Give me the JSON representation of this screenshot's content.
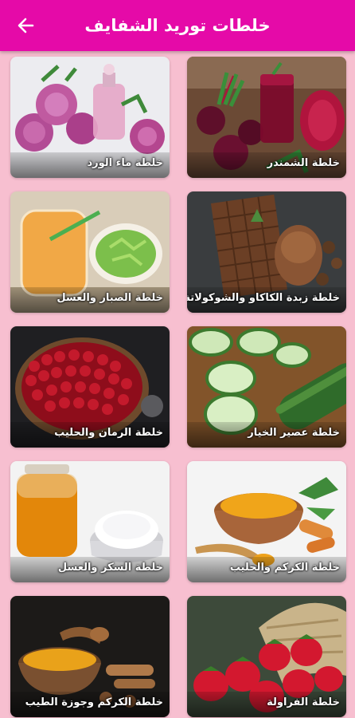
{
  "appbar": {
    "title": "خلطات توريد الشفايف",
    "back_icon": "arrow-left-icon",
    "color": "#e50aa8"
  },
  "background_color": "#f7bfd0",
  "cards": [
    {
      "label": "خلطة الشمندر"
    },
    {
      "label": "خلطة ماء الورد"
    },
    {
      "label": "خلطة زبدة الكاكاو والشوكولاتة"
    },
    {
      "label": "خلطة الصبار والعسل"
    },
    {
      "label": "خلطة عصير الخيار"
    },
    {
      "label": "خلطة الرمان والحليب"
    },
    {
      "label": "خلطة الكركم والحليب"
    },
    {
      "label": "خلطة السكر والعسل"
    },
    {
      "label": "خلطة الفراولة"
    },
    {
      "label": "خلطة الكركم وجوزة الطيب"
    }
  ]
}
